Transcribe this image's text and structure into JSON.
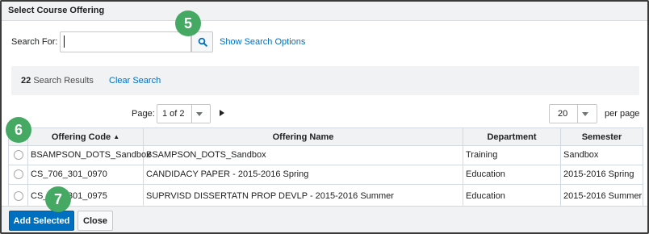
{
  "dialog": {
    "title": "Select Course Offering"
  },
  "search": {
    "label": "Search For:",
    "value": "",
    "placeholder": "",
    "show_options_label": "Show Search Options"
  },
  "results": {
    "count": "22",
    "label": "Search Results",
    "clear_label": "Clear Search"
  },
  "pagination": {
    "page_label": "Page:",
    "page_value": "1 of 2",
    "per_page_value": "20",
    "per_page_label": "per page"
  },
  "table": {
    "headers": [
      "Offering Code",
      "Offering Name",
      "Department",
      "Semester"
    ],
    "sort_indicator": "▲",
    "rows": [
      {
        "code": "BSAMPSON_DOTS_Sandbox",
        "name": "BSAMPSON_DOTS_Sandbox",
        "department": "Training",
        "semester": "Sandbox"
      },
      {
        "code": "CS_706_301_0970",
        "name": "CANDIDACY PAPER - 2015-2016 Spring",
        "department": "Education",
        "semester": "2015-2016 Spring"
      },
      {
        "code": "CS_706_301_0975",
        "name": "SUPRVISD DISSERTATN PROP DEVLP - 2015-2016 Summer",
        "department": "Education",
        "semester": "2015-2016 Summer"
      }
    ]
  },
  "footer": {
    "add_selected_label": "Add Selected",
    "close_label": "Close"
  },
  "callouts": [
    "5",
    "6",
    "7"
  ],
  "colors": {
    "accent": "#006fbf",
    "callout": "#45a964",
    "header_bg": "#f1f2f3"
  },
  "icons": {
    "search_button": "search-icon",
    "next_page": "next-page-icon",
    "dropdown": "chevron-down-icon"
  }
}
